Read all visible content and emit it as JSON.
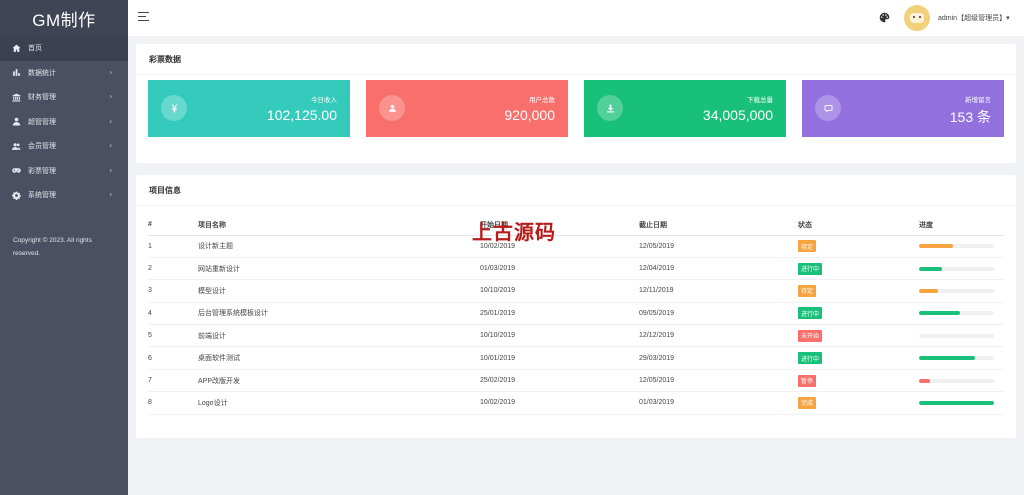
{
  "sidebar": {
    "logo": "GM制作",
    "items": [
      {
        "label": "首页",
        "icon": "home-icon",
        "active": true,
        "has_children": false
      },
      {
        "label": "数据统计",
        "icon": "bar-chart-icon",
        "active": false,
        "has_children": true
      },
      {
        "label": "财务管理",
        "icon": "bank-icon",
        "active": false,
        "has_children": true
      },
      {
        "label": "超管管理",
        "icon": "user-icon",
        "active": false,
        "has_children": true
      },
      {
        "label": "会员管理",
        "icon": "users-icon",
        "active": false,
        "has_children": true
      },
      {
        "label": "彩票管理",
        "icon": "gamepad-icon",
        "active": false,
        "has_children": true
      },
      {
        "label": "系统管理",
        "icon": "gear-icon",
        "active": false,
        "has_children": true
      }
    ],
    "chevron": "›",
    "copyright": "Copyright © 2023. All rights reserved."
  },
  "header": {
    "user": "admin【超级管理员】▾"
  },
  "stats_panel": {
    "title": "彩票数据",
    "cards": [
      {
        "label": "今日收入",
        "value": "102,125.00",
        "icon": "yen-icon",
        "color": "#35cbbc"
      },
      {
        "label": "用户总数",
        "value": "920,000",
        "icon": "person-icon",
        "color": "#f86f6b"
      },
      {
        "label": "下载总量",
        "value": "34,005,000",
        "icon": "download-icon",
        "color": "#18c07a"
      },
      {
        "label": "新增留言",
        "value": "153 条",
        "icon": "message-icon",
        "color": "#9270de"
      }
    ]
  },
  "project_panel": {
    "title": "项目信息",
    "columns": [
      "#",
      "项目名称",
      "开始日期",
      "截止日期",
      "状态",
      "进度"
    ],
    "rows": [
      {
        "num": "1",
        "name": "设计新主题",
        "start": "10/02/2019",
        "end": "12/05/2019",
        "status": "待定",
        "status_color": "#f7a440",
        "progress": 0.45,
        "bar_color": "#f7a440"
      },
      {
        "num": "2",
        "name": "网站重新设计",
        "start": "01/03/2019",
        "end": "12/04/2019",
        "status": "进行中",
        "status_color": "#18c07a",
        "progress": 0.3,
        "bar_color": "#18c07a"
      },
      {
        "num": "3",
        "name": "模型设计",
        "start": "10/10/2019",
        "end": "12/11/2019",
        "status": "待定",
        "status_color": "#f7a440",
        "progress": 0.25,
        "bar_color": "#f7a440"
      },
      {
        "num": "4",
        "name": "后台管理系统模板设计",
        "start": "25/01/2019",
        "end": "09/05/2019",
        "status": "进行中",
        "status_color": "#18c07a",
        "progress": 0.55,
        "bar_color": "#18c07a"
      },
      {
        "num": "5",
        "name": "前端设计",
        "start": "10/10/2019",
        "end": "12/12/2019",
        "status": "未开始",
        "status_color": "#f86f6b",
        "progress": 0.0,
        "bar_color": "#f86f6b"
      },
      {
        "num": "6",
        "name": "桌面软件测试",
        "start": "10/01/2019",
        "end": "29/03/2019",
        "status": "进行中",
        "status_color": "#18c07a",
        "progress": 0.75,
        "bar_color": "#18c07a"
      },
      {
        "num": "7",
        "name": "APP改版开发",
        "start": "25/02/2019",
        "end": "12/05/2019",
        "status": "暂停",
        "status_color": "#f86f6b",
        "progress": 0.15,
        "bar_color": "#f86f6b"
      },
      {
        "num": "8",
        "name": "Logo设计",
        "start": "10/02/2019",
        "end": "01/03/2019",
        "status": "完成",
        "status_color": "#f7a440",
        "progress": 1.0,
        "bar_color": "#18c07a"
      }
    ]
  },
  "watermark": "上古源码"
}
